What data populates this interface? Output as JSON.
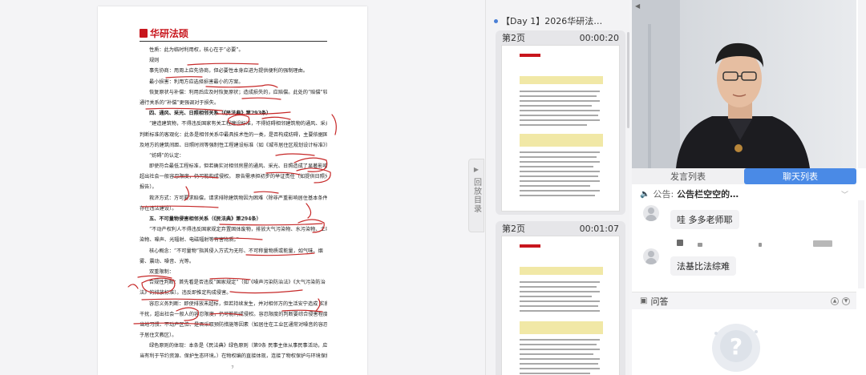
{
  "document": {
    "logo_text": "华研法硕",
    "page_number": "7",
    "lines": [
      {
        "text": "性质：此为临时利用权，核心在于“必要”。",
        "indent": true
      },
      {
        "text": "规则",
        "indent": true
      },
      {
        "text": "事先协商：用周上应先协商，但必要性本身应进为提供便利的强制理由。",
        "indent": true
      },
      {
        "text": "最小损害：利用方应选择损害最小的方案。",
        "indent": true
      },
      {
        "text": "恢复原状与补偿：利用后应及时恢复原状；造成损失的，应赔偿。此处的“赔偿”较",
        "indent": true
      },
      {
        "text": "通行关系的“补偿”更强调对于损失。",
        "indent": false
      },
      {
        "text": "四、通风、采光、日照相邻关系（《民法典》第293条）",
        "indent": true,
        "head": true
      },
      {
        "text": "“建造建筑物，不得违反国家有关工程建设标准，不得妨碍相邻建筑物的通风、采光和日照。”",
        "indent": true
      },
      {
        "text": "判断标准的客观化：此条是相邻关系中最具技术性的一类，是否构成妨碍，主要依据国家",
        "indent": false
      },
      {
        "text": "及地方的建筑间距、日照时间等强制性工程建设标准（如《城市居住区规划设计标准》）",
        "indent": false
      },
      {
        "text": "“妨碍”的认定：",
        "indent": true
      },
      {
        "text": "即使符合最低工程标准，但若确实对相邻房屋的通风、采光、日照造成了显著影响，且",
        "indent": true
      },
      {
        "text": "超出社会一般容忍限度，仍可能构成侵权。 原告需承担初步的举证责任（如提供日照分析",
        "indent": false
      },
      {
        "text": "报告）。",
        "indent": false
      },
      {
        "text": "救济方式：方可要求赔偿，请求排除建筑物因为困难（除非严重影响居住基本条件或",
        "indent": true
      },
      {
        "text": "存在违法建设）。",
        "indent": false
      },
      {
        "text": "五、不可量物侵害相邻关系（《民法典》第294条）",
        "indent": true,
        "head": true
      },
      {
        "text": "“不动产权利人不得违反国家规定弃置固体废物，排放大气污染物、水污染物、土壤污",
        "indent": true
      },
      {
        "text": "染物、噪声、光辐射、电磁辐射等有害物质。”",
        "indent": false
      },
      {
        "text": "核心概念：“不可量物”指其侵入方式为无形、不可称量物质或能量，如气味、烟",
        "indent": true
      },
      {
        "text": "雾、震动、噪音、光等。",
        "indent": false
      },
      {
        "text": "双重限制：",
        "indent": true
      },
      {
        "text": "合规性判断：首先看是否违反“国家规定”（如《噪声污染防治法》《大气污染防治",
        "indent": true
      },
      {
        "text": "法》的排放标准）。违反即推定构成侵害。",
        "indent": false
      },
      {
        "text": "容忍义务判断：即使排放未超标，但若持续发生，并对相邻方的生活安宁造成 实质性",
        "indent": true
      },
      {
        "text": "干扰，超出社会一般人的容忍限度，仍可能构成侵权。容忍限度的判断要综合侵害程度、",
        "indent": false
      },
      {
        "text": "当地习惯、不动产区位、是否采取预防措施等因素（如居住在工业区通常对噪音的容忍度高",
        "indent": false
      },
      {
        "text": "于居住文教区）。",
        "indent": false
      },
      {
        "text": "绿色原则的体现：本条是《民法典》绿色原则（第9条 民事主体从事民事活动，应",
        "indent": true
      },
      {
        "text": "当有利于节约资源、保护生态环境。）在物权编的直接体现，连接了物权保护与环境保护。",
        "indent": false
      }
    ]
  },
  "directory": {
    "handle_label": "回放目录",
    "title": "【Day 1】2026华研法…",
    "slides": [
      {
        "label": "第2页",
        "time": "00:00:20"
      },
      {
        "label": "第2页",
        "time": "00:01:07"
      }
    ]
  },
  "right_panel": {
    "tabs": [
      {
        "label": "发言列表",
        "active": false
      },
      {
        "label": "聊天列表",
        "active": true
      }
    ],
    "notice_label": "公告:",
    "notice_text": "公告栏空空的…",
    "messages": [
      {
        "text": "哇 多多老师耶"
      },
      {
        "text": "法基比法综难"
      }
    ],
    "qa_title": "问答",
    "colors": {
      "tab_active": "#4a8ae6",
      "brand_red": "#c8161d"
    }
  }
}
